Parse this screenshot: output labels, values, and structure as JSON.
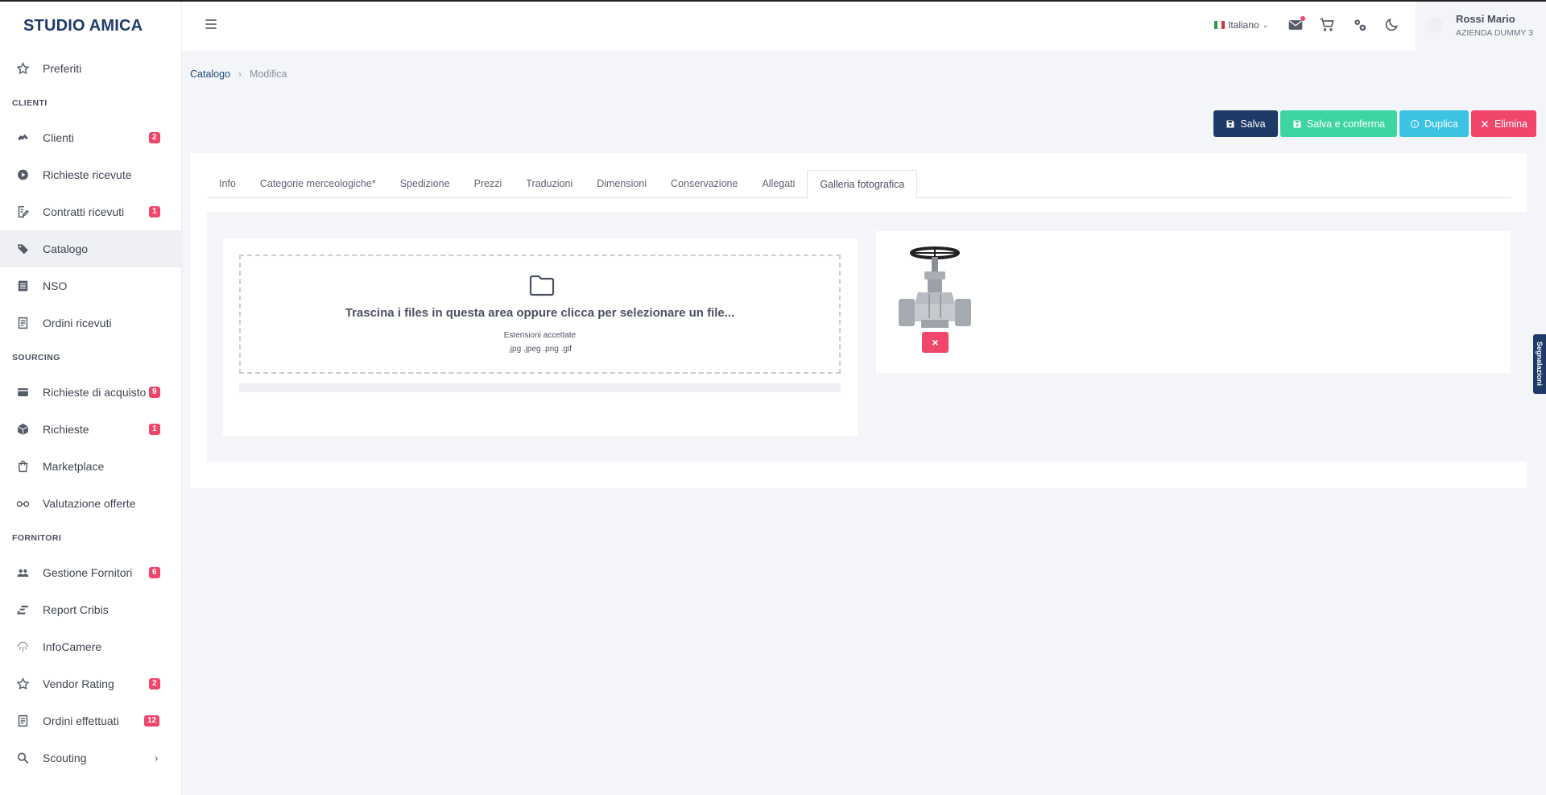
{
  "brand": {
    "name": "STUDIO AMICA"
  },
  "sidebar": {
    "preferiti": {
      "label": "Preferiti"
    },
    "sections": {
      "clienti": "CLIENTI",
      "sourcing": "SOURCING",
      "fornitori": "FORNITORI"
    },
    "items": {
      "clienti": {
        "label": "Clienti",
        "badge": "2"
      },
      "richieste_ricevute": {
        "label": "Richieste ricevute"
      },
      "contratti_ricevuti": {
        "label": "Contratti ricevuti",
        "badge": "1"
      },
      "catalogo": {
        "label": "Catalogo"
      },
      "nso": {
        "label": "NSO"
      },
      "ordini_ricevuti": {
        "label": "Ordini ricevuti"
      },
      "richieste_di_acquisto": {
        "label": "Richieste di acquisto",
        "badge": "9"
      },
      "richieste": {
        "label": "Richieste",
        "badge": "1"
      },
      "marketplace": {
        "label": "Marketplace"
      },
      "valutazione_offerte": {
        "label": "Valutazione offerte"
      },
      "gestione_fornitori": {
        "label": "Gestione Fornitori",
        "badge": "6"
      },
      "report_cribis": {
        "label": "Report Cribis"
      },
      "infocamere": {
        "label": "InfoCamere"
      },
      "vendor_rating": {
        "label": "Vendor Rating",
        "badge": "2"
      },
      "ordini_effettuati": {
        "label": "Ordini effettuati",
        "badge": "12"
      },
      "scouting": {
        "label": "Scouting"
      }
    }
  },
  "header": {
    "language": "Italiano",
    "user": {
      "name": "Rossi Mario",
      "company": "AZIENDA DUMMY 3"
    }
  },
  "breadcrumb": {
    "parent": "Catalogo",
    "separator": "›",
    "current": "Modifica"
  },
  "actions": {
    "save": "Salva",
    "save_confirm": "Salva e conferma",
    "duplicate": "Duplica",
    "delete": "Elimina"
  },
  "tabs": [
    "Info",
    "Categorie merceologiche*",
    "Spedizione",
    "Prezzi",
    "Traduzioni",
    "Dimensioni",
    "Conservazione",
    "Allegati",
    "Galleria fotografica"
  ],
  "active_tab": "Galleria fotografica",
  "upload": {
    "dropzone_text": "Trascina i files in questa area oppure clicca per selezionare un file...",
    "extensions_label": "Estensioni accettate",
    "extensions_list": ".jpg .jpeg .png .gif",
    "progress": 0
  },
  "gallery": {
    "remove_label": "×"
  },
  "side_tab": {
    "label": "Segnalazioni"
  },
  "colors": {
    "brand": "#1e3a66",
    "badge": "#f0466b",
    "save": "#1e3a66",
    "save_confirm": "#3ed6a0",
    "duplicate": "#3cc3e3",
    "delete": "#f0466b"
  }
}
